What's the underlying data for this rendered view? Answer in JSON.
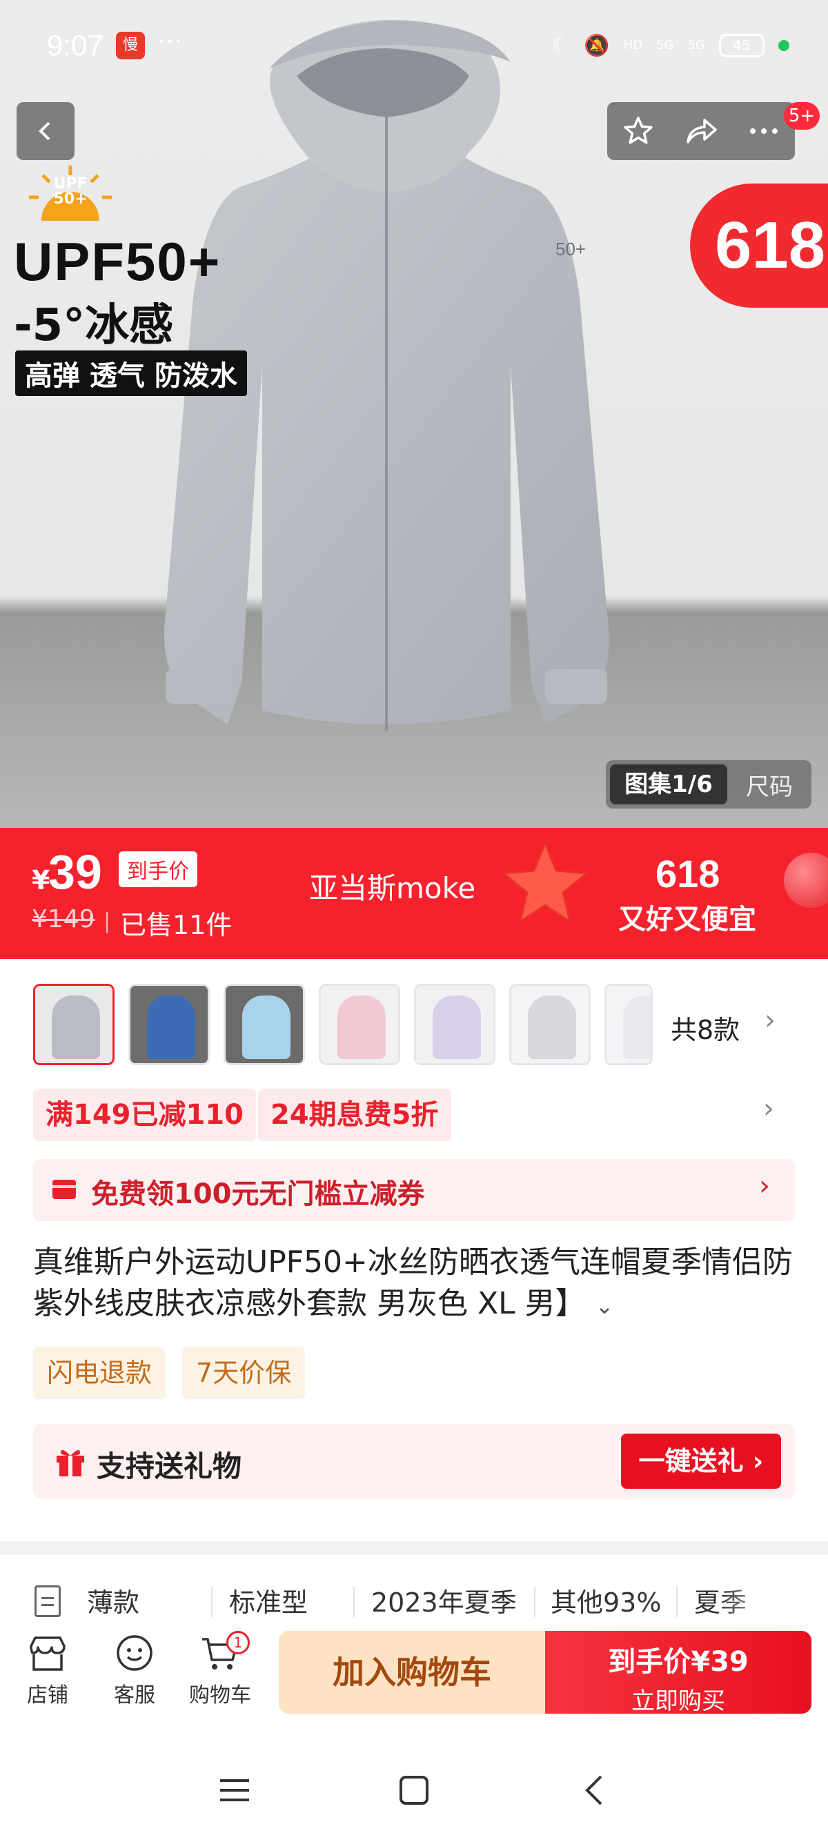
{
  "status_bar": {
    "time": "9:07",
    "app_badge": "慢",
    "more": "···",
    "network_1": "5G",
    "network_2": "5G",
    "hd": "HD",
    "battery": "45"
  },
  "header": {
    "back_icon": "back-arrow-icon",
    "favorite_icon": "star-icon",
    "share_icon": "share-icon",
    "more_icon": "more-icon",
    "notification_badge": "5+"
  },
  "hero": {
    "promo_badge": "618",
    "upf_badge": "UPF 50+",
    "title_line1": "UPF50+",
    "title_line2": "-5°冰感",
    "feature_tags": "高弹 透气 防泼水",
    "gallery_tab": "图集1/6",
    "size_tab": "尺码"
  },
  "price_banner": {
    "currency": "¥",
    "price": "39",
    "price_tag": "到手价",
    "original_price": "¥149",
    "sold": "已售11件",
    "shop_name": "亚当斯moke",
    "promo_618": "618",
    "promo_slogan": "又好又便宜"
  },
  "variants": {
    "count_label": "共8款",
    "thumbnails": [
      {
        "bg": "#e9e9ec",
        "color": "#b9bcc2"
      },
      {
        "bg": "#6d6d6d",
        "color": "#3d6bb5"
      },
      {
        "bg": "#6b6b6b",
        "color": "#a9d3ec"
      },
      {
        "bg": "#f1f1f3",
        "color": "#f1c9d2"
      },
      {
        "bg": "#f1f1f3",
        "color": "#d8cfe9"
      },
      {
        "bg": "#f4f4f6",
        "color": "#d6d8dc"
      },
      {
        "bg": "#f4f4f6",
        "color": "#e8e9ee"
      }
    ]
  },
  "coupons": {
    "discount": "满149已减110",
    "installment": "24期息费5折"
  },
  "voucher": {
    "text": "免费领100元无门槛立减券"
  },
  "product": {
    "title": "真维斯户外运动UPF50+冰丝防晒衣透气连帽夏季情侣防紫外线皮肤衣凉感外套款 男灰色 XL 男】",
    "service_tags": [
      "闪电退款",
      "7天价保"
    ]
  },
  "gift": {
    "text": "支持送礼物",
    "button": "一键送礼 ›"
  },
  "specs": [
    "薄款",
    "标准型",
    "2023年夏季",
    "其他93%",
    "夏季"
  ],
  "bottom_bar": {
    "shop": "店铺",
    "service": "客服",
    "cart": "购物车",
    "cart_count": "1",
    "add_to_cart": "加入购物车",
    "buy_price": "到手价¥39",
    "buy_now": "立即购买"
  },
  "colors": {
    "accent_red": "#f5212d",
    "cart_button": "#fde2c3",
    "service_tag": "#fdf3e4"
  }
}
